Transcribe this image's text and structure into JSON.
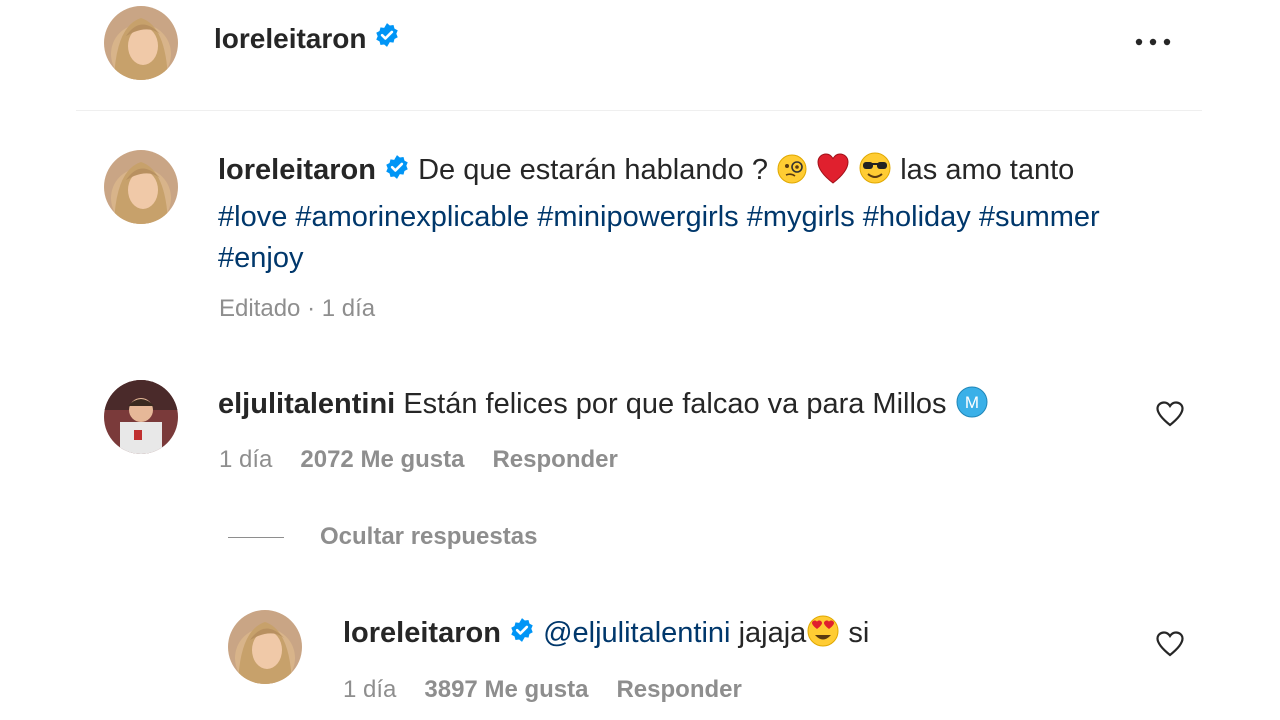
{
  "header": {
    "username": "loreleitaron",
    "more_icon": "more-horizontal-icon"
  },
  "caption": {
    "username": "loreleitaron",
    "text_before": "De que estarán hablando ?",
    "emojis": [
      "face-with-monocle-emoji",
      "red-heart-emoji",
      "smiling-face-with-sunglasses-emoji"
    ],
    "text_after": "las amo tanto",
    "hashtags": [
      "#love",
      "#amorinexplicable",
      "#minipowergirls",
      "#mygirls",
      "#holiday",
      "#summer",
      "#enjoy"
    ],
    "meta_edited": "Editado · 1 día"
  },
  "comment": {
    "username": "eljulitalentini",
    "text": "Están felices por que falcao va para Millos",
    "badge_emoji": "circled-m-emoji",
    "time": "1 día",
    "likes": "2072 Me gusta",
    "reply_label": "Responder",
    "hide_replies_label": "Ocultar respuestas"
  },
  "reply": {
    "username": "loreleitaron",
    "mention": "@eljulitalentini",
    "text_before": "jajaja",
    "emoji": "smiling-face-with-heart-eyes-emoji",
    "text_after": "si",
    "time": "1 día",
    "likes": "3897 Me gusta",
    "reply_label": "Responder"
  },
  "colors": {
    "text": "#262626",
    "secondary": "#8e8e8e",
    "link": "#00376b",
    "verified": "#0095f6"
  }
}
